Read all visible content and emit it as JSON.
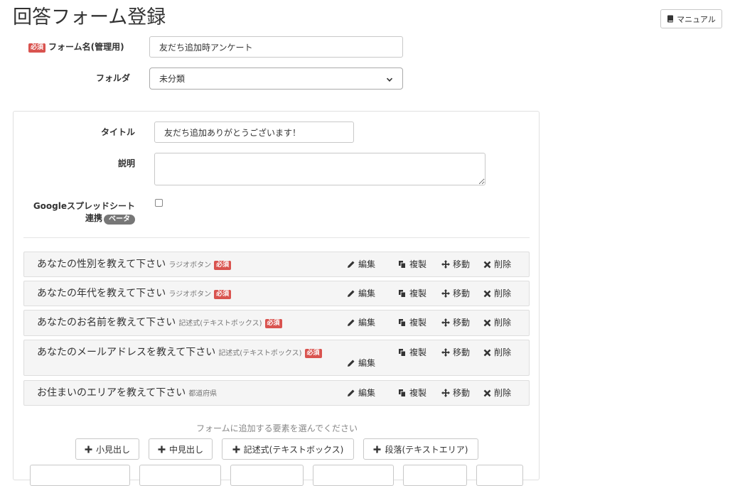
{
  "page": {
    "title": "回答フォーム登録"
  },
  "header": {
    "manual_label": "マニュアル"
  },
  "form_name": {
    "label": "フォーム名(管理用)",
    "required_badge": "必須",
    "value": "友だち追加時アンケート"
  },
  "folder": {
    "label": "フォルダ",
    "selected": "未分類"
  },
  "panel": {
    "title_label": "タイトル",
    "title_value": "友だち追加ありがとうございます！",
    "description_label": "説明",
    "description_value": "",
    "sheets_label_line1": "Googleスプレッドシート",
    "sheets_label_line2": "連携",
    "beta_badge": "ベータ"
  },
  "actions": {
    "edit": "編集",
    "copy": "複製",
    "move": "移動",
    "delete": "削除"
  },
  "items": [
    {
      "title": "あなたの性別を教えて下さい",
      "type": "ラジオボタン",
      "required": "必須"
    },
    {
      "title": "あなたの年代を教えて下さい",
      "type": "ラジオボタン",
      "required": "必須"
    },
    {
      "title": "あなたのお名前を教えて下さい",
      "type": "記述式(テキストボックス)",
      "required": "必須"
    },
    {
      "title": "あなたのメールアドレスを教えて下さい",
      "type": "記述式(テキストボックス)",
      "required": "必須"
    },
    {
      "title": "お住まいのエリアを教えて下さい",
      "type": "都道府県",
      "required": ""
    }
  ],
  "add_section": {
    "hint": "フォームに追加する要素を選んでください",
    "buttons": [
      "小見出し",
      "中見出し",
      "記述式(テキストボックス)",
      "段落(テキストエリア)"
    ]
  }
}
